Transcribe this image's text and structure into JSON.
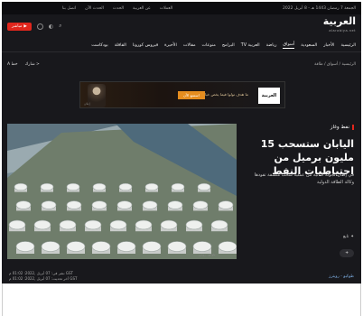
{
  "utility": {
    "date": "الجمعة 7 رمضان 1443 هـ - 8 أبريل 2022",
    "links": [
      "العملات",
      "عن العربية",
      "الحدث",
      "الحدث الآن",
      "اتصل بنا"
    ]
  },
  "header": {
    "logo": "العربية",
    "logo_sub": "alarabiya.net",
    "live_label": "مباشر"
  },
  "nav": {
    "items": [
      "الرئيسية",
      "الأخبار",
      "السعودية",
      "أسواق",
      "رياضة",
      "العربية TV",
      "البرامج",
      "منوعات",
      "مقالات",
      "الأخيرة",
      "فيروس كورونا",
      "القافلة",
      "بودكاست"
    ],
    "active_index": 3
  },
  "breadcrumb": {
    "path": "الرئيسية / أسواق / طاقة",
    "share": "شارك",
    "font_size": "خط"
  },
  "ad": {
    "brand": "العربية",
    "text": "ما هدف تولوا فيما يخص خيارات الاستثمار",
    "button": "استمع الآن",
    "tag": "إعلان"
  },
  "article": {
    "category": "نفط وغاز",
    "headline": "اليابان ستسحب 15 مليون برميل من احتياطيات النفط",
    "summary": "في إطار الجولة الثانية من عملية سحب منسقة تقودها وكالة الطاقة الدولية",
    "caption": "طوكيو - رويترز",
    "published": "نشر في: 07 أبريل ,2022: 01:02 م GST",
    "updated": "آخر تحديث: 07 أبريل ,2022: 01:02 م GST",
    "source": "طوكيو - رويترز",
    "follow": "تابع"
  },
  "colors": {
    "accent": "#e1261c",
    "background": "#18181c",
    "link": "#7fb1e6"
  }
}
